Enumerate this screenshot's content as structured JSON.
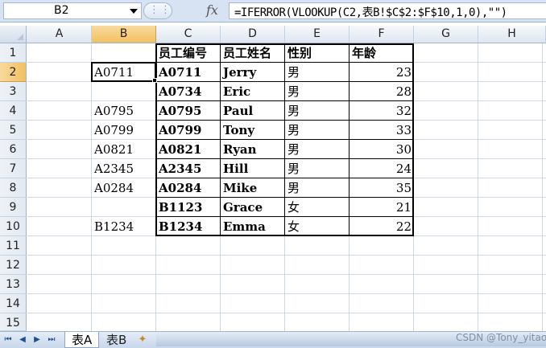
{
  "formula_bar": {
    "name_box": "B2",
    "fx_label": "fx",
    "formula": "=IFERROR(VLOOKUP(C2,表B!$C$2:$F$10,1,0),\"\")"
  },
  "columns": [
    "A",
    "B",
    "C",
    "D",
    "E",
    "F",
    "G",
    "H"
  ],
  "rows": [
    "1",
    "2",
    "3",
    "4",
    "5",
    "6",
    "7",
    "8",
    "9",
    "10",
    "11",
    "12",
    "13",
    "14",
    "15"
  ],
  "active_cell": "B2",
  "colB": [
    "",
    "A0711",
    "",
    "A0795",
    "A0799",
    "A0821",
    "A2345",
    "A0284",
    "",
    "B1234"
  ],
  "table": {
    "headers": [
      "员工编号",
      "员工姓名",
      "性别",
      "年龄"
    ],
    "rows": [
      [
        "A0711",
        "Jerry",
        "男",
        "23"
      ],
      [
        "A0734",
        "Eric",
        "男",
        "28"
      ],
      [
        "A0795",
        "Paul",
        "男",
        "32"
      ],
      [
        "A0799",
        "Tony",
        "男",
        "33"
      ],
      [
        "A0821",
        "Ryan",
        "男",
        "30"
      ],
      [
        "A2345",
        "Hill",
        "男",
        "24"
      ],
      [
        "A0284",
        "Mike",
        "男",
        "35"
      ],
      [
        "B1123",
        "Grace",
        "女",
        "21"
      ],
      [
        "B1234",
        "Emma",
        "女",
        "22"
      ]
    ]
  },
  "sheet_tabs": [
    "表A",
    "表B"
  ],
  "active_sheet": "表A",
  "watermark": "CSDN @Tony_yitao"
}
